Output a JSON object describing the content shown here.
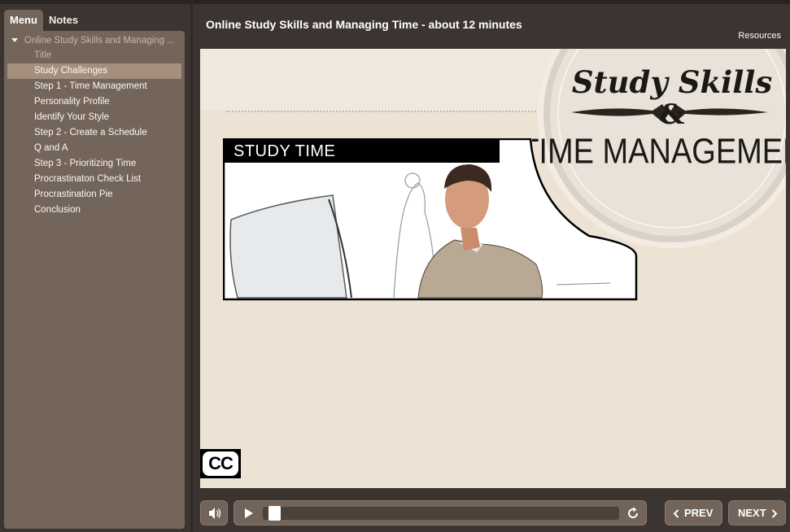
{
  "tabs": {
    "menu": "Menu",
    "notes": "Notes"
  },
  "menu": {
    "root": "Online Study Skills and Managing ...",
    "items": [
      {
        "label": "Title",
        "state": "visited"
      },
      {
        "label": "Study Challenges",
        "state": "selected"
      },
      {
        "label": "Step 1 - Time Management",
        "state": "normal"
      },
      {
        "label": "Personality Profile",
        "state": "normal"
      },
      {
        "label": "Identify Your Style",
        "state": "normal"
      },
      {
        "label": "Step 2 - Create a Schedule",
        "state": "normal"
      },
      {
        "label": "Q and A",
        "state": "normal"
      },
      {
        "label": "Step 3 - Prioritizing Time",
        "state": "normal"
      },
      {
        "label": "Procrastinaton Check List",
        "state": "normal"
      },
      {
        "label": "Procrastination Pie",
        "state": "normal"
      },
      {
        "label": "Conclusion",
        "state": "normal"
      }
    ]
  },
  "header": {
    "title": "Online Study Skills and Managing Time - about 12 minutes",
    "resources": "Resources"
  },
  "slide": {
    "logo_line1": "Study Skills",
    "logo_amp": "&",
    "logo_line2": "TIME MANAGEMENT",
    "image_label": "STUDY TIME",
    "cc": "CC"
  },
  "player": {
    "prev": "PREV",
    "next": "NEXT",
    "progress": 0.02
  },
  "colors": {
    "sidebar_bg": "#74655a",
    "selected_bg": "#a48f7f",
    "app_bg": "#3b3431",
    "slide_bg": "#ede3d5"
  },
  "icons": [
    "caret-down-icon",
    "volume-icon",
    "play-icon",
    "replay-icon",
    "chevron-left-icon",
    "chevron-right-icon"
  ]
}
